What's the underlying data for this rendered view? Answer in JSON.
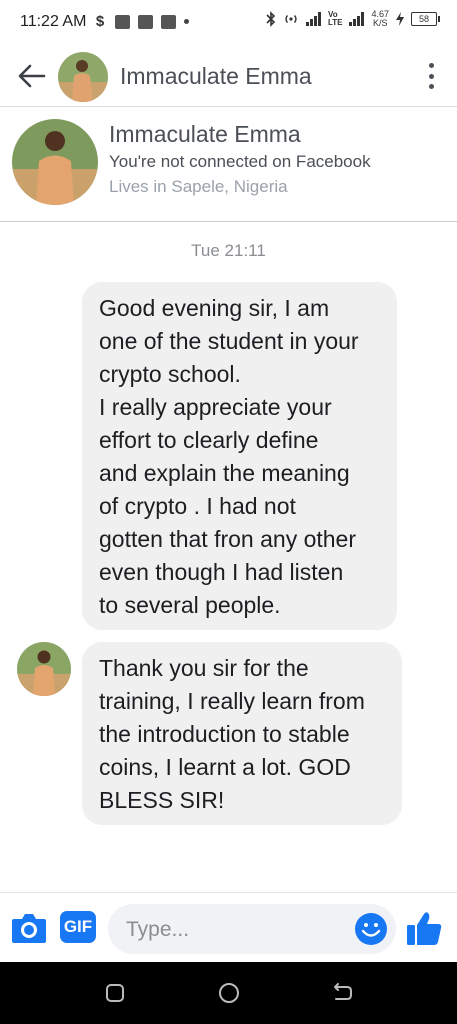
{
  "status_bar": {
    "time": "11:22 AM",
    "network_speed": "4.67",
    "network_speed_unit": "K/S",
    "battery": "58",
    "icons": [
      "sim-icon",
      "notification-icon",
      "bluetooth-icon",
      "hotspot-icon",
      "signal-icon",
      "volte-icon",
      "battery-icon"
    ]
  },
  "header": {
    "contact_name": "Immaculate Emma",
    "back_icon": "arrow-left-icon",
    "menu_icon": "more-vertical-icon"
  },
  "profile": {
    "name": "Immaculate Emma",
    "connection_status": "You're not connected on Facebook",
    "location": "Lives in Sapele, Nigeria"
  },
  "conversation": {
    "timestamp": "Tue 21:11",
    "messages": [
      {
        "lines": [
          "Good evening sir, I am",
          "one of the student in your",
          "crypto school.",
          "I really appreciate your",
          "effort to clearly define",
          "and explain the meaning",
          "of crypto . I had not",
          "gotten that fron any other",
          "even though I had listen",
          "to several people."
        ]
      },
      {
        "lines": [
          "Thank you sir for the",
          "training, I really learn from",
          "the introduction to stable",
          "coins, I learnt a lot. GOD",
          "BLESS SIR!"
        ]
      }
    ]
  },
  "composer": {
    "placeholder": "Type...",
    "gif_label": "GIF",
    "value": ""
  },
  "colors": {
    "accent": "#1877f2",
    "bubble": "#f1f0f0",
    "text_secondary": "#4b4f56",
    "text_muted": "#9aa1ad"
  }
}
